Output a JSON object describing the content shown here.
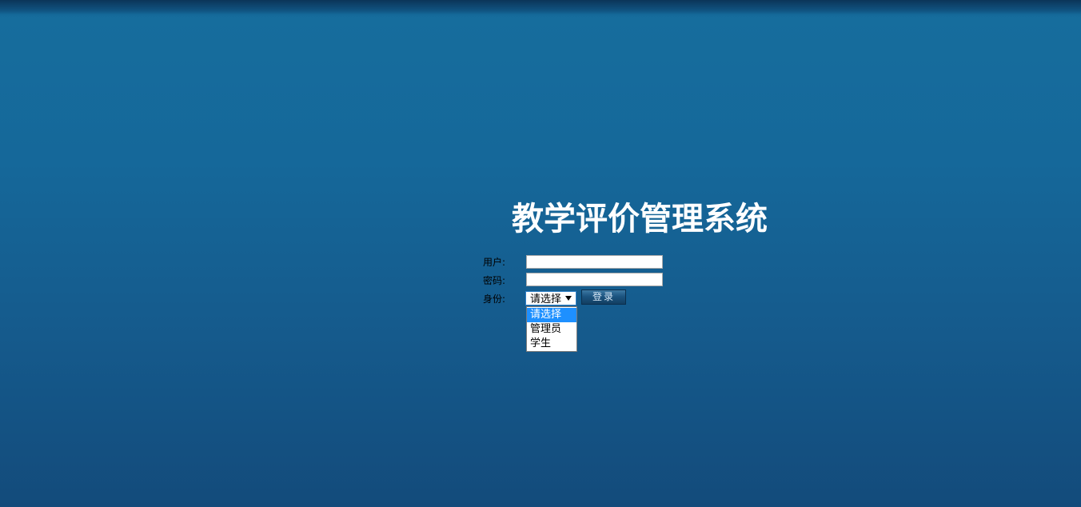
{
  "title": "教学评价管理系统",
  "form": {
    "user_label": "用户:",
    "user_value": "",
    "password_label": "密码:",
    "password_value": "",
    "role_label": "身份:",
    "role_selected": "请选择",
    "role_options": [
      "请选择",
      "管理员",
      "学生"
    ],
    "login_label": "登录"
  },
  "colors": {
    "background_top": "#166d9d",
    "background_bottom": "#134b7b",
    "title": "#ffffff",
    "option_highlight": "#1e90ff"
  }
}
